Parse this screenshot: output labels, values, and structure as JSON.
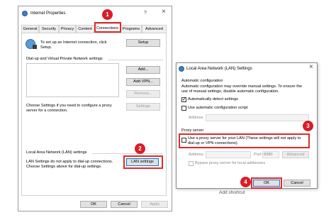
{
  "background_text": {
    "add_shortcut": "Add shortcut"
  },
  "internet_props": {
    "title": "Internet Properties",
    "help": "?",
    "close": "×",
    "tabs": [
      "General",
      "Security",
      "Privacy",
      "Content",
      "Connections",
      "Programs",
      "Advanced"
    ],
    "setup_text": "To set up an Internet connection, click Setup.",
    "setup_button": "Setup",
    "dialup_heading": "Dial-up and Virtual Private Network settings",
    "add_button": "Add...",
    "add_vpn_button": "Add VPN...",
    "remove_button": "Remove...",
    "settings_button": "Settings",
    "choose_text_1": "Choose Settings if you need to configure a proxy",
    "choose_text_2": "server for a connection.",
    "lan_heading": "Local Area Network (LAN) settings",
    "lan_text_1": "LAN Settings do not apply to dial-up connections.",
    "lan_text_2": "Choose Settings above for dial-up settings.",
    "lan_settings_button": "LAN settings",
    "ok": "OK",
    "cancel": "Cancel",
    "apply": "Apply"
  },
  "lan_dialog": {
    "title": "Local Area Network (LAN) Settings",
    "close": "×",
    "auto_heading": "Automatic configuration",
    "auto_desc_1": "Automatic configuration may override manual settings. To ensure the",
    "auto_desc_2": "use of manual settings, disable automatic configuration.",
    "auto_detect_label": "Automatically detect settings",
    "auto_detect_checked": true,
    "use_script_label": "Use automatic configuration script",
    "use_script_checked": false,
    "address_label": "Address",
    "proxy_heading": "Proxy server",
    "proxy_checkbox_label_1": "Use a proxy server for your LAN (These settings will not apply to",
    "proxy_checkbox_label_2": "dial-up or VPN connections).",
    "proxy_checked": false,
    "proxy_address_label": "Address:",
    "port_label": "Port:",
    "port_value": "8080",
    "advanced_button": "Advanced",
    "bypass_label": "Bypass proxy server for local addresses",
    "ok": "OK",
    "cancel": "Cancel"
  },
  "callouts": [
    "1",
    "2",
    "3",
    "4"
  ],
  "colors": {
    "callout": "#d81e27",
    "highlight": "#e02a2a",
    "focus_blue": "#0078d7"
  }
}
